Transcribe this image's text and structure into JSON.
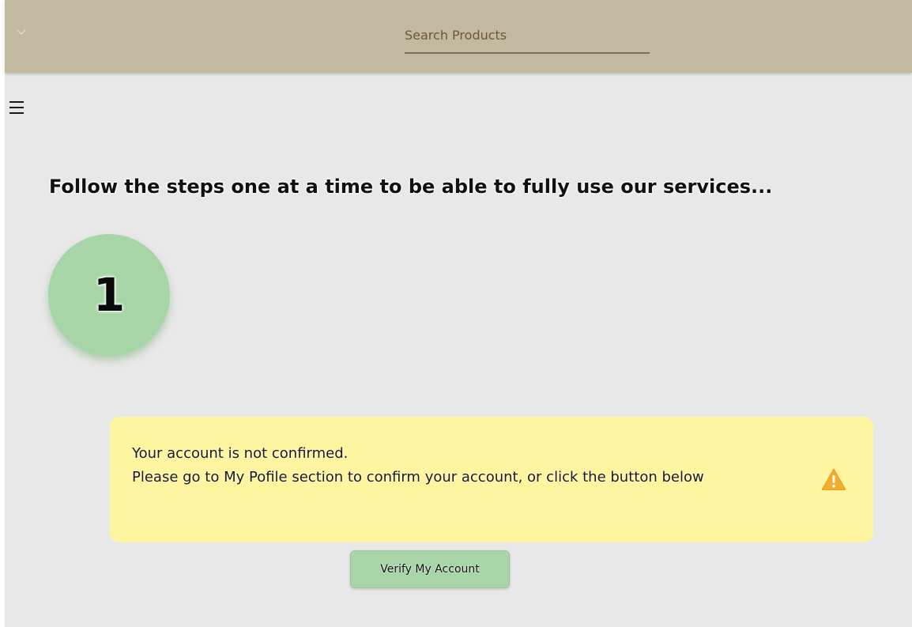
{
  "header": {
    "search_placeholder": "Search Products",
    "dropdown_icon": "chevron-down-icon",
    "background_color": "#c2b9a1"
  },
  "nav": {
    "menu_icon": "hamburger-menu-icon"
  },
  "main": {
    "headline": "Follow the steps one at a time to be able to fully use our services...",
    "current_step": "1",
    "step_color": "#a8d5a8"
  },
  "alert": {
    "line1": "Your account is not confirmed.",
    "line2": "Please go to My Pofile section to confirm your account, or click the button below",
    "icon": "warning-icon",
    "background_color": "#fff49f",
    "icon_color": "#f0ad2e"
  },
  "actions": {
    "verify_label": "Verify My Account"
  }
}
